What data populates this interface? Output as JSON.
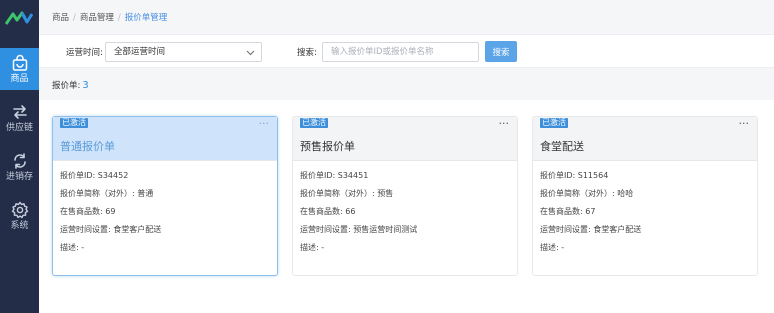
{
  "sidebar": {
    "items": [
      {
        "label": "商品",
        "icon": "shopping-bag-icon",
        "active": true
      },
      {
        "label": "供应链",
        "icon": "swap-arrows-icon",
        "active": false
      },
      {
        "label": "进销存",
        "icon": "cycle-icon",
        "active": false
      },
      {
        "label": "系统",
        "icon": "gear-icon",
        "active": false
      }
    ]
  },
  "breadcrumb": [
    "商品",
    "商品管理",
    "报价单管理"
  ],
  "filter": {
    "time_label": "运营时间:",
    "time_value": "全部运营时间",
    "search_label": "搜索:",
    "search_placeholder": "输入报价单ID或报价单名称",
    "search_button": "搜索"
  },
  "summary": {
    "label": "报价单:",
    "count": "3"
  },
  "cards": [
    {
      "badge": "已激活",
      "title": "普通报价单",
      "id_line": "报价单ID: S34452",
      "alias_line": "报价单简称（对外）: 普通",
      "count_line": "在售商品数: 69",
      "time_line": "运营时间设置: 食堂客户配送",
      "desc_line": "描述: -"
    },
    {
      "badge": "已激活",
      "title": "预售报价单",
      "id_line": "报价单ID: S34451",
      "alias_line": "报价单简称（对外）: 预售",
      "count_line": "在售商品数: 66",
      "time_line": "运营时间设置: 预售运营时间测试",
      "desc_line": "描述: -"
    },
    {
      "badge": "已激活",
      "title": "食堂配送",
      "id_line": "报价单ID: S11564",
      "alias_line": "报价单简称（对外）: 哈哈",
      "count_line": "在售商品数: 67",
      "time_line": "运营时间设置: 食堂客户配送",
      "desc_line": "描述: -"
    }
  ],
  "more_glyph": "···",
  "colors": {
    "sidebar": "#232d47",
    "active": "#2f8fe0",
    "badge": "#3d8edb",
    "button": "#5ba4e8"
  }
}
